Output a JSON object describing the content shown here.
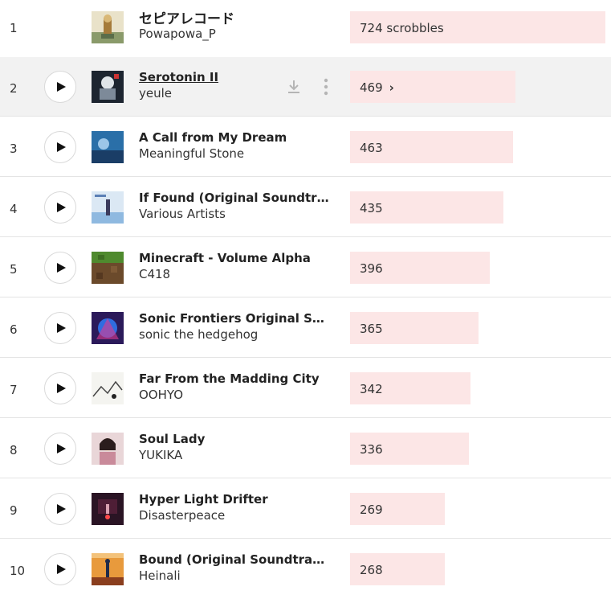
{
  "tracks": [
    {
      "rank": "1",
      "title": "セピアレコード",
      "artist": "Powapowa_P",
      "scrobbles": "724 scrobbles",
      "value": 724
    },
    {
      "rank": "2",
      "title": "Serotonin II",
      "artist": "yeule",
      "scrobbles": "469",
      "value": 469
    },
    {
      "rank": "3",
      "title": "A Call from My Dream",
      "artist": "Meaningful Stone",
      "scrobbles": "463",
      "value": 463
    },
    {
      "rank": "4",
      "title": "If Found (Original Soundtrack)",
      "artist": "Various Artists",
      "scrobbles": "435",
      "value": 435
    },
    {
      "rank": "5",
      "title": "Minecraft - Volume Alpha",
      "artist": "C418",
      "scrobbles": "396",
      "value": 396
    },
    {
      "rank": "6",
      "title": "Sonic Frontiers Original Soun…",
      "artist": "sonic the hedgehog",
      "scrobbles": "365",
      "value": 365
    },
    {
      "rank": "7",
      "title": "Far From the Madding City",
      "artist": "OOHYO",
      "scrobbles": "342",
      "value": 342
    },
    {
      "rank": "8",
      "title": "Soul Lady",
      "artist": "YUKIKA",
      "scrobbles": "336",
      "value": 336
    },
    {
      "rank": "9",
      "title": "Hyper Light Drifter",
      "artist": "Disasterpeace",
      "scrobbles": "269",
      "value": 269
    },
    {
      "rank": "10",
      "title": "Bound (Original Soundtrack)",
      "artist": "Heinali",
      "scrobbles": "268",
      "value": 268
    }
  ],
  "hover_chevron": "›",
  "colors": {
    "bar": "#fce6e6",
    "hover_row": "#f2f2f2",
    "text": "#222222"
  },
  "icons": {
    "play": "play-icon",
    "download": "download-icon",
    "more": "more-vertical-icon",
    "chevron": "chevron-right-icon"
  }
}
